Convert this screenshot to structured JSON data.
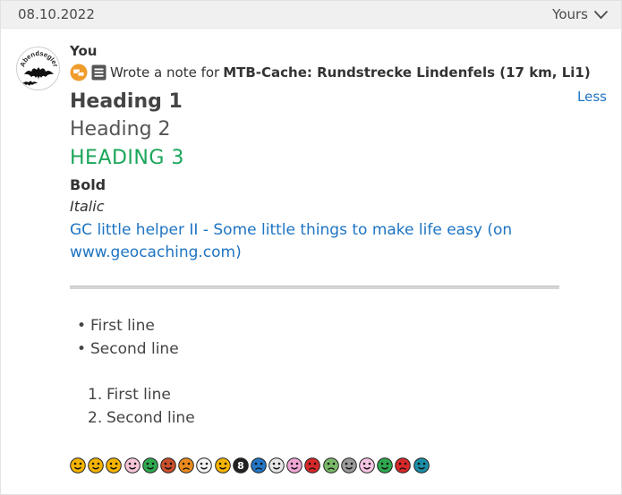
{
  "header": {
    "date": "08.10.2022",
    "filter_label": "Yours"
  },
  "log": {
    "author": "You",
    "action_text": "Wrote a note for",
    "cache_name": "MTB-Cache: Rundstrecke Lindenfels (17 km, Li1)",
    "toggle_label": "Less",
    "avatar_text": "Abendsegler"
  },
  "note": {
    "heading1": "Heading 1",
    "heading2": "Heading 2",
    "heading3": "HEADING 3",
    "bold": "Bold",
    "italic": "Italic",
    "link_text": "GC little helper II - Some little things to make life easy (on www.geocaching.com)",
    "bullets": [
      "First line",
      "Second line"
    ],
    "numbered": [
      {
        "num": "1.",
        "text": "First line"
      },
      {
        "num": "2.",
        "text": "Second line"
      }
    ]
  },
  "icons": {
    "cache_type": "multi-cache-icon",
    "log_type": "note-icon",
    "smileys": [
      {
        "name": "smile-icon",
        "color": "#f5b400"
      },
      {
        "name": "big-grin-icon",
        "color": "#f5b400"
      },
      {
        "name": "cool-icon",
        "color": "#f5b400"
      },
      {
        "name": "blush-icon",
        "color": "#f7c6d9"
      },
      {
        "name": "tongue-icon",
        "color": "#2fa84f"
      },
      {
        "name": "evil-icon",
        "color": "#c8502c"
      },
      {
        "name": "frown-icon",
        "color": "#ec8c1e"
      },
      {
        "name": "clown-icon",
        "color": "#f3f3f3"
      },
      {
        "name": "blackeye-icon",
        "color": "#f5b400"
      },
      {
        "name": "eightball-icon",
        "color": "#222222"
      },
      {
        "name": "sad-icon",
        "color": "#2476c4"
      },
      {
        "name": "shy-icon",
        "color": "#e8e8e8"
      },
      {
        "name": "shocked-icon",
        "color": "#f0a6d6"
      },
      {
        "name": "angry-icon",
        "color": "#d8282a"
      },
      {
        "name": "dead-icon",
        "color": "#7ab86a"
      },
      {
        "name": "sleepy-icon",
        "color": "#9a9a9a"
      },
      {
        "name": "kisses-icon",
        "color": "#f7c6e4"
      },
      {
        "name": "approve-icon",
        "color": "#2fa84f"
      },
      {
        "name": "disapprove-icon",
        "color": "#d8282a"
      },
      {
        "name": "question-icon",
        "color": "#1c8fa6"
      }
    ]
  }
}
